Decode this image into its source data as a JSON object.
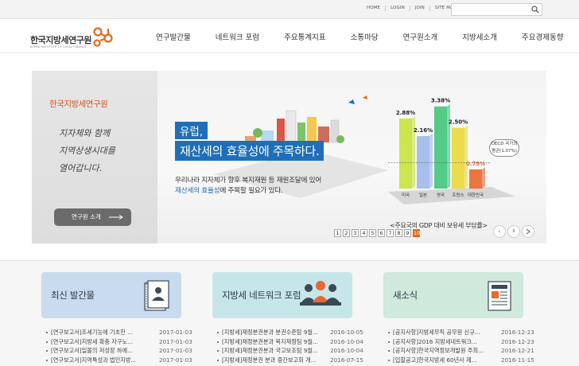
{
  "util": {
    "links": [
      "HOME",
      "LOGIN",
      "JOIN",
      "SITE MAP"
    ],
    "search_placeholder": ""
  },
  "logo": {
    "name_ko": "한국지방세연구원",
    "name_en": "KOREA INSTITUTE OF LOCAL FINANCE",
    "accent": "#e26a1a"
  },
  "gnb": [
    "연구발간물",
    "네트워크 포럼",
    "주요통계지표",
    "소통마당",
    "연구원소개",
    "지방세소개",
    "주요경제동향"
  ],
  "banner": {
    "left_title": "한국지방세연구원",
    "left_lines": [
      "지자체와 함께",
      "지역상생시대를",
      "열어갑니다."
    ],
    "intro_button": "연구원 소개",
    "headline1": "유럽,",
    "headline2_a": "재산세의 효율성",
    "headline2_b": "에 주목하다.",
    "desc1": "우리나라 지자체가 향후 복지재원 등 재원조달에 있어",
    "desc2_em": "재산세의 효율성",
    "desc2_rest": "에 주목할 필요가 있다.",
    "oecd_note_1": "OECD 국가의",
    "oecd_note_2": "평균(1.07%)",
    "chart_caption": "<주요국의 GDP 대비 보유세 부담률>",
    "pages": [
      "1",
      "2",
      "3",
      "4",
      "5",
      "6",
      "7",
      "8",
      "9",
      "10"
    ],
    "active_page": "10",
    "prev_icon": "‹",
    "pause_icon": "II"
  },
  "chart_data": {
    "type": "bar",
    "title": "주요국의 GDP 대비 보유세 부담률",
    "categories": [
      "미국",
      "일본",
      "영국",
      "프랑스",
      "대한민국"
    ],
    "values": [
      2.88,
      2.16,
      3.38,
      2.5,
      0.79
    ],
    "value_labels": [
      "2.88%",
      "2.16%",
      "3.38%",
      "2.50%",
      "0.79%"
    ],
    "colors": [
      "#c8e23c",
      "#9fb8ea",
      "#3fc77a",
      "#e9d83a",
      "#e8682e"
    ],
    "reference_value": 1.07,
    "ylim": [
      0,
      3.6
    ]
  },
  "cards": [
    {
      "title": "최신 발간물",
      "bg": "#c9dbef",
      "items": [
        {
          "text": "[연구보고서]조세기능에 기초한 ...",
          "date": "2017-01-03"
        },
        {
          "text": "[연구보고서]지방세 확충 자구노...",
          "date": "2017-01-03"
        },
        {
          "text": "[연구보고서]일몰의 저성장 하에...",
          "date": "2017-01-03"
        },
        {
          "text": "[연구보고서]지역특성과 법인지방...",
          "date": "2017-01-03"
        }
      ]
    },
    {
      "title": "지방세 네트워크 포럼",
      "bg": "#c6e6ea",
      "items": [
        {
          "text": "[지방세]재정분권분과 분권수준탐 9월...",
          "date": "2016-10-05"
        },
        {
          "text": "[지방세]재정분권분과 복지재정팀 9월...",
          "date": "2016-10-04"
        },
        {
          "text": "[지방세]재정분권분과 국고보조팀 9월...",
          "date": "2016-10-04"
        },
        {
          "text": "[지방세]재정분권 분과 중간보고회 개...",
          "date": "2016-07-15"
        }
      ]
    },
    {
      "title": "새소식",
      "bg": "#cfe9dc",
      "items": [
        {
          "text": "[공지사항]지방세무직 공무원 신규...",
          "date": "2016-12-23"
        },
        {
          "text": "[공지사항]2016 지방세네트워크...",
          "date": "2016-12-23"
        },
        {
          "text": "[공지사항]한국지역정보개발원 주최...",
          "date": "2016-12-21"
        },
        {
          "text": "[입찰공고]한국지방세 60년사 제...",
          "date": "2016-11-15"
        }
      ]
    }
  ]
}
